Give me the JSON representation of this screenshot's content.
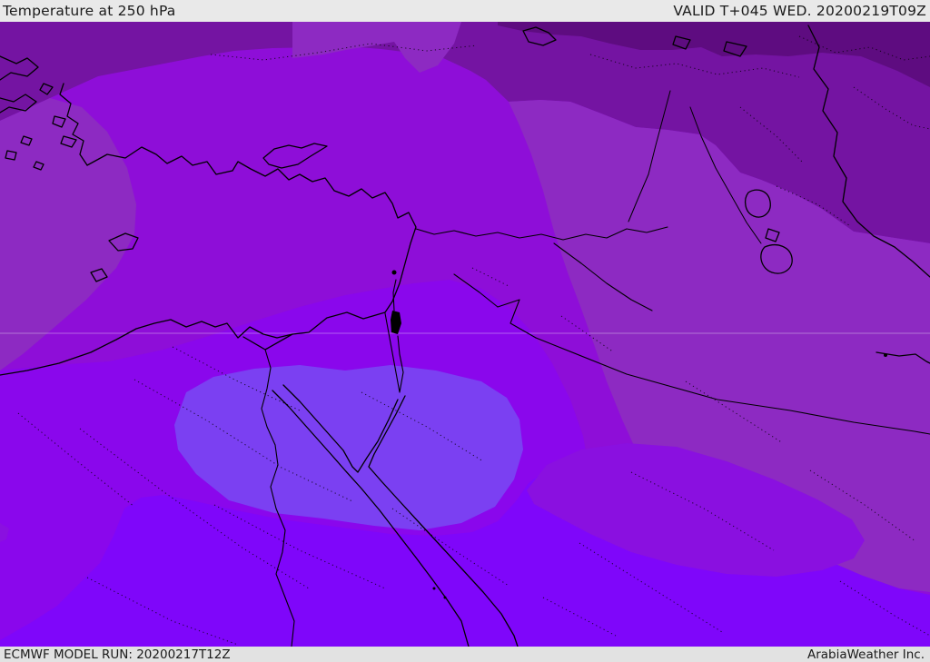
{
  "header": {
    "title": "Temperature at 250 hPa",
    "valid": "VALID T+045 WED. 20200219T09Z",
    "bg": "#E9E9E9",
    "text_color": "#1A1A1A"
  },
  "footer": {
    "model_run": "ECMWF MODEL RUN: 20200217T12Z",
    "attribution": "ArabiaWeather Inc.",
    "bg": "#E2E2E2",
    "text_color": "#1A1A1A"
  },
  "map": {
    "parameter": "Temperature",
    "level": "250 hPa",
    "model": "ECMWF",
    "region": "Middle East / Eastern Mediterranean",
    "palette": {
      "darkest_band": "#5E0C80",
      "dark_band": "#7414A2",
      "medium_band": "#8D2AC2",
      "bright_band": "#8E0ED8",
      "violet_band": "#8A07EC",
      "violet_blob": "#8A10E0",
      "blue_band": "#7F06FA",
      "light_patch": "#7B40F2",
      "coastline": "#000000",
      "water_fill": "#000000",
      "gridline": "rgba(255,255,255,0.35)"
    }
  }
}
